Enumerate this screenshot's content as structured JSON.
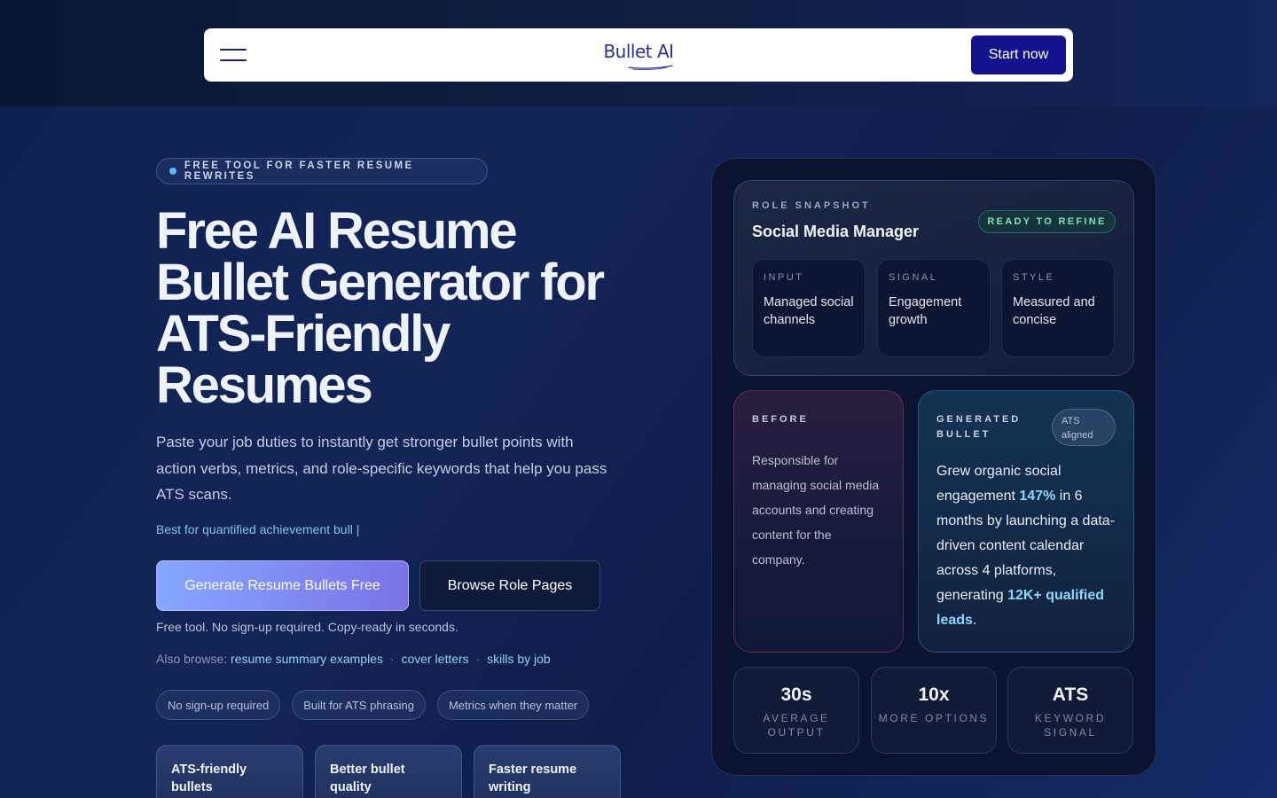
{
  "nav": {
    "logo": "Bullet AI",
    "cta": "Start now"
  },
  "hero": {
    "badge": "FREE TOOL FOR FASTER RESUME REWRITES",
    "title": "Free AI Resume Bullet Generator for ATS-Friendly Resumes",
    "subtitle": "Paste your job duties to instantly get stronger bullet points with action verbs, metrics, and role-specific keywords that help you pass ATS scans.",
    "typed_line": "Best for quantified achievement bull",
    "typed_caret": "|",
    "primary_cta": "Generate Resume Bullets Free",
    "secondary_cta": "Browse Role Pages",
    "note": "Free tool. No sign-up required. Copy-ready in seconds.",
    "also_label": "Also browse:",
    "also_links": [
      "resume summary examples",
      "cover letters",
      "skills by job"
    ],
    "also_sep": "·",
    "chips": [
      "No sign-up required",
      "Built for ATS phrasing",
      "Metrics when they matter"
    ],
    "features": [
      "ATS-friendly bullets",
      "Better bullet quality",
      "Faster resume writing"
    ]
  },
  "card": {
    "snapshot_label": "ROLE SNAPSHOT",
    "role": "Social Media Manager",
    "status": "READY TO REFINE",
    "mini": [
      {
        "key": "INPUT",
        "value": "Managed social channels"
      },
      {
        "key": "SIGNAL",
        "value": "Engagement growth"
      },
      {
        "key": "STYLE",
        "value": "Measured and concise"
      }
    ],
    "before_label": "BEFORE",
    "before_text": "Responsible for managing social media accounts and creating content for the company.",
    "generated_label": "GENERATED BULLET",
    "ats_tag": "ATS aligned",
    "generated": {
      "p1": "Grew organic social engagement ",
      "h1": "147%",
      "p2": " in 6 months by launching a data-driven content calendar across 4 platforms, generating ",
      "h2": "12K+ qualified leads",
      "p3": "."
    },
    "stats": [
      {
        "value": "30s",
        "label": "AVERAGE OUTPUT"
      },
      {
        "value": "10x",
        "label": "MORE OPTIONS"
      },
      {
        "value": "ATS",
        "label": "KEYWORD SIGNAL"
      }
    ]
  },
  "colors": {
    "brand": "#13148c",
    "accent_link": "#8fd3f7",
    "ready_green": "#7de3b7",
    "highlight": "#8fd6ff"
  }
}
